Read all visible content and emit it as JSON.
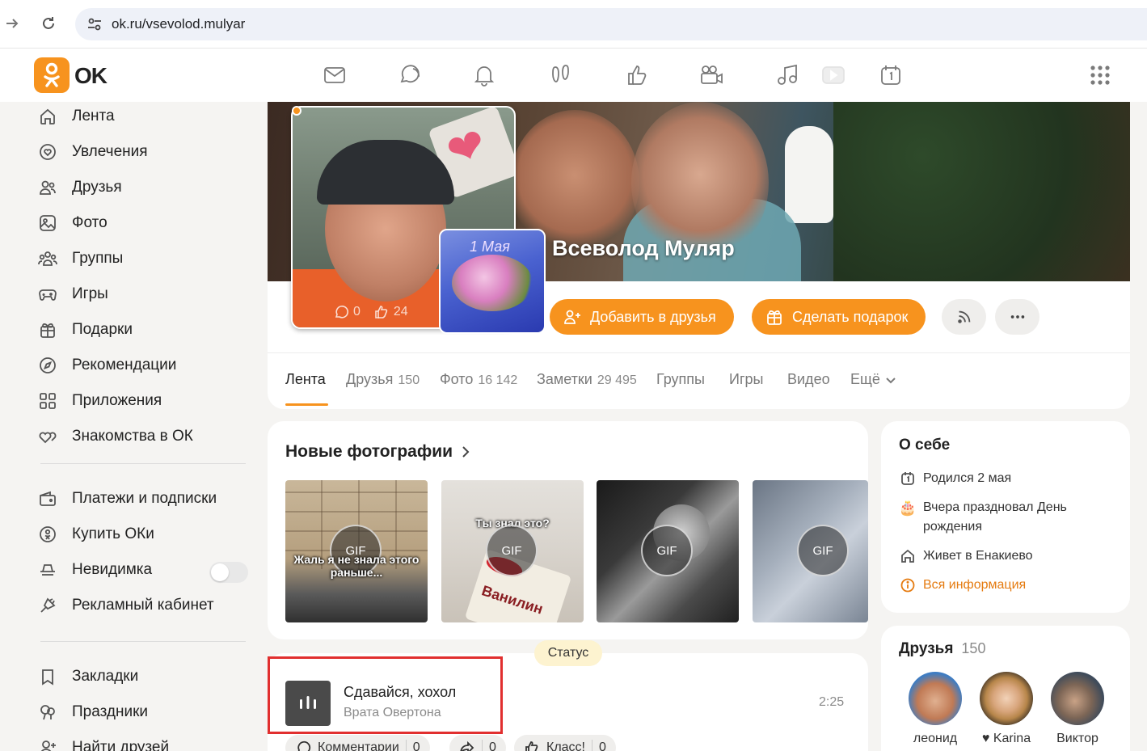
{
  "browser": {
    "url": "ok.ru/vsevolod.mulyar"
  },
  "header": {
    "logo_text": "OK",
    "icons": [
      "mail-icon",
      "chat-icon",
      "bell-icon",
      "footprints-icon",
      "like-icon",
      "video-camera-icon",
      "music-icon",
      "video-play-icon",
      "calendar-icon",
      "apps-grid-icon"
    ]
  },
  "sidebar": {
    "main_items": [
      {
        "label": "Лента",
        "icon": "home-icon"
      },
      {
        "label": "Увлечения",
        "icon": "heart-circle-icon"
      },
      {
        "label": "Друзья",
        "icon": "friends-icon"
      },
      {
        "label": "Фото",
        "icon": "photo-icon"
      },
      {
        "label": "Группы",
        "icon": "groups-icon"
      },
      {
        "label": "Игры",
        "icon": "gamepad-icon"
      },
      {
        "label": "Подарки",
        "icon": "gift-icon"
      },
      {
        "label": "Рекомендации",
        "icon": "compass-icon"
      },
      {
        "label": "Приложения",
        "icon": "apps-icon"
      },
      {
        "label": "Знакомства в ОК",
        "icon": "hearts-icon"
      }
    ],
    "service_items": [
      {
        "label": "Платежи и подписки",
        "icon": "wallet-icon"
      },
      {
        "label": "Купить ОКи",
        "icon": "coin-icon"
      },
      {
        "label": "Невидимка",
        "icon": "incognito-icon"
      },
      {
        "label": "Рекламный кабинет",
        "icon": "megaphone-icon"
      }
    ],
    "extra_items": [
      {
        "label": "Закладки",
        "icon": "bookmark-icon"
      },
      {
        "label": "Праздники",
        "icon": "balloons-icon"
      },
      {
        "label": "Найти друзей",
        "icon": "add-friend-icon"
      }
    ],
    "invisible_enabled": false
  },
  "profile": {
    "name": "Всеволод Муляр",
    "avatar_comments": "0",
    "avatar_likes": "24",
    "gift_caption": "1 Мая",
    "add_friend_label": "Добавить в друзья",
    "gift_button_label": "Сделать подарок"
  },
  "tabs": [
    {
      "label": "Лента",
      "count": "",
      "active": true
    },
    {
      "label": "Друзья",
      "count": "150",
      "active": false
    },
    {
      "label": "Фото",
      "count": "16 142",
      "active": false
    },
    {
      "label": "Заметки",
      "count": "29 495",
      "active": false
    },
    {
      "label": "Группы",
      "count": "",
      "active": false
    },
    {
      "label": "Игры",
      "count": "",
      "active": false
    },
    {
      "label": "Видео",
      "count": "",
      "active": false
    },
    {
      "label": "Ещё",
      "count": "",
      "active": false
    }
  ],
  "new_photos": {
    "title": "Новые фотографии",
    "items": [
      {
        "badge": "GIF",
        "caption": "Жаль я не знала этого раньше..."
      },
      {
        "badge": "GIF",
        "caption": "Ты знал это?"
      },
      {
        "badge": "GIF",
        "caption": ""
      },
      {
        "badge": "GIF",
        "caption": ""
      }
    ],
    "box_text": "Ванилин"
  },
  "status": {
    "chip": "Статус",
    "track_title": "Сдавайся, хохол",
    "track_artist": "Врата Овертона",
    "duration": "2:25",
    "comments_label": "Комментарии",
    "comments_count": "0",
    "shares_count": "0",
    "likes_label": "Класс!",
    "likes_count": "0"
  },
  "about": {
    "title": "О себе",
    "birthday": "Родился 2 мая",
    "celebrated": "Вчера праздновал День рождения",
    "lives": "Живет в Енакиево",
    "all_info": "Вся информация"
  },
  "friends": {
    "title": "Друзья",
    "count": "150",
    "items": [
      {
        "name": "леонид"
      },
      {
        "name": "♥ Karina"
      },
      {
        "name": "Виктор"
      }
    ]
  },
  "colors": {
    "accent": "#f7931e",
    "highlight": "#e12f2f"
  }
}
